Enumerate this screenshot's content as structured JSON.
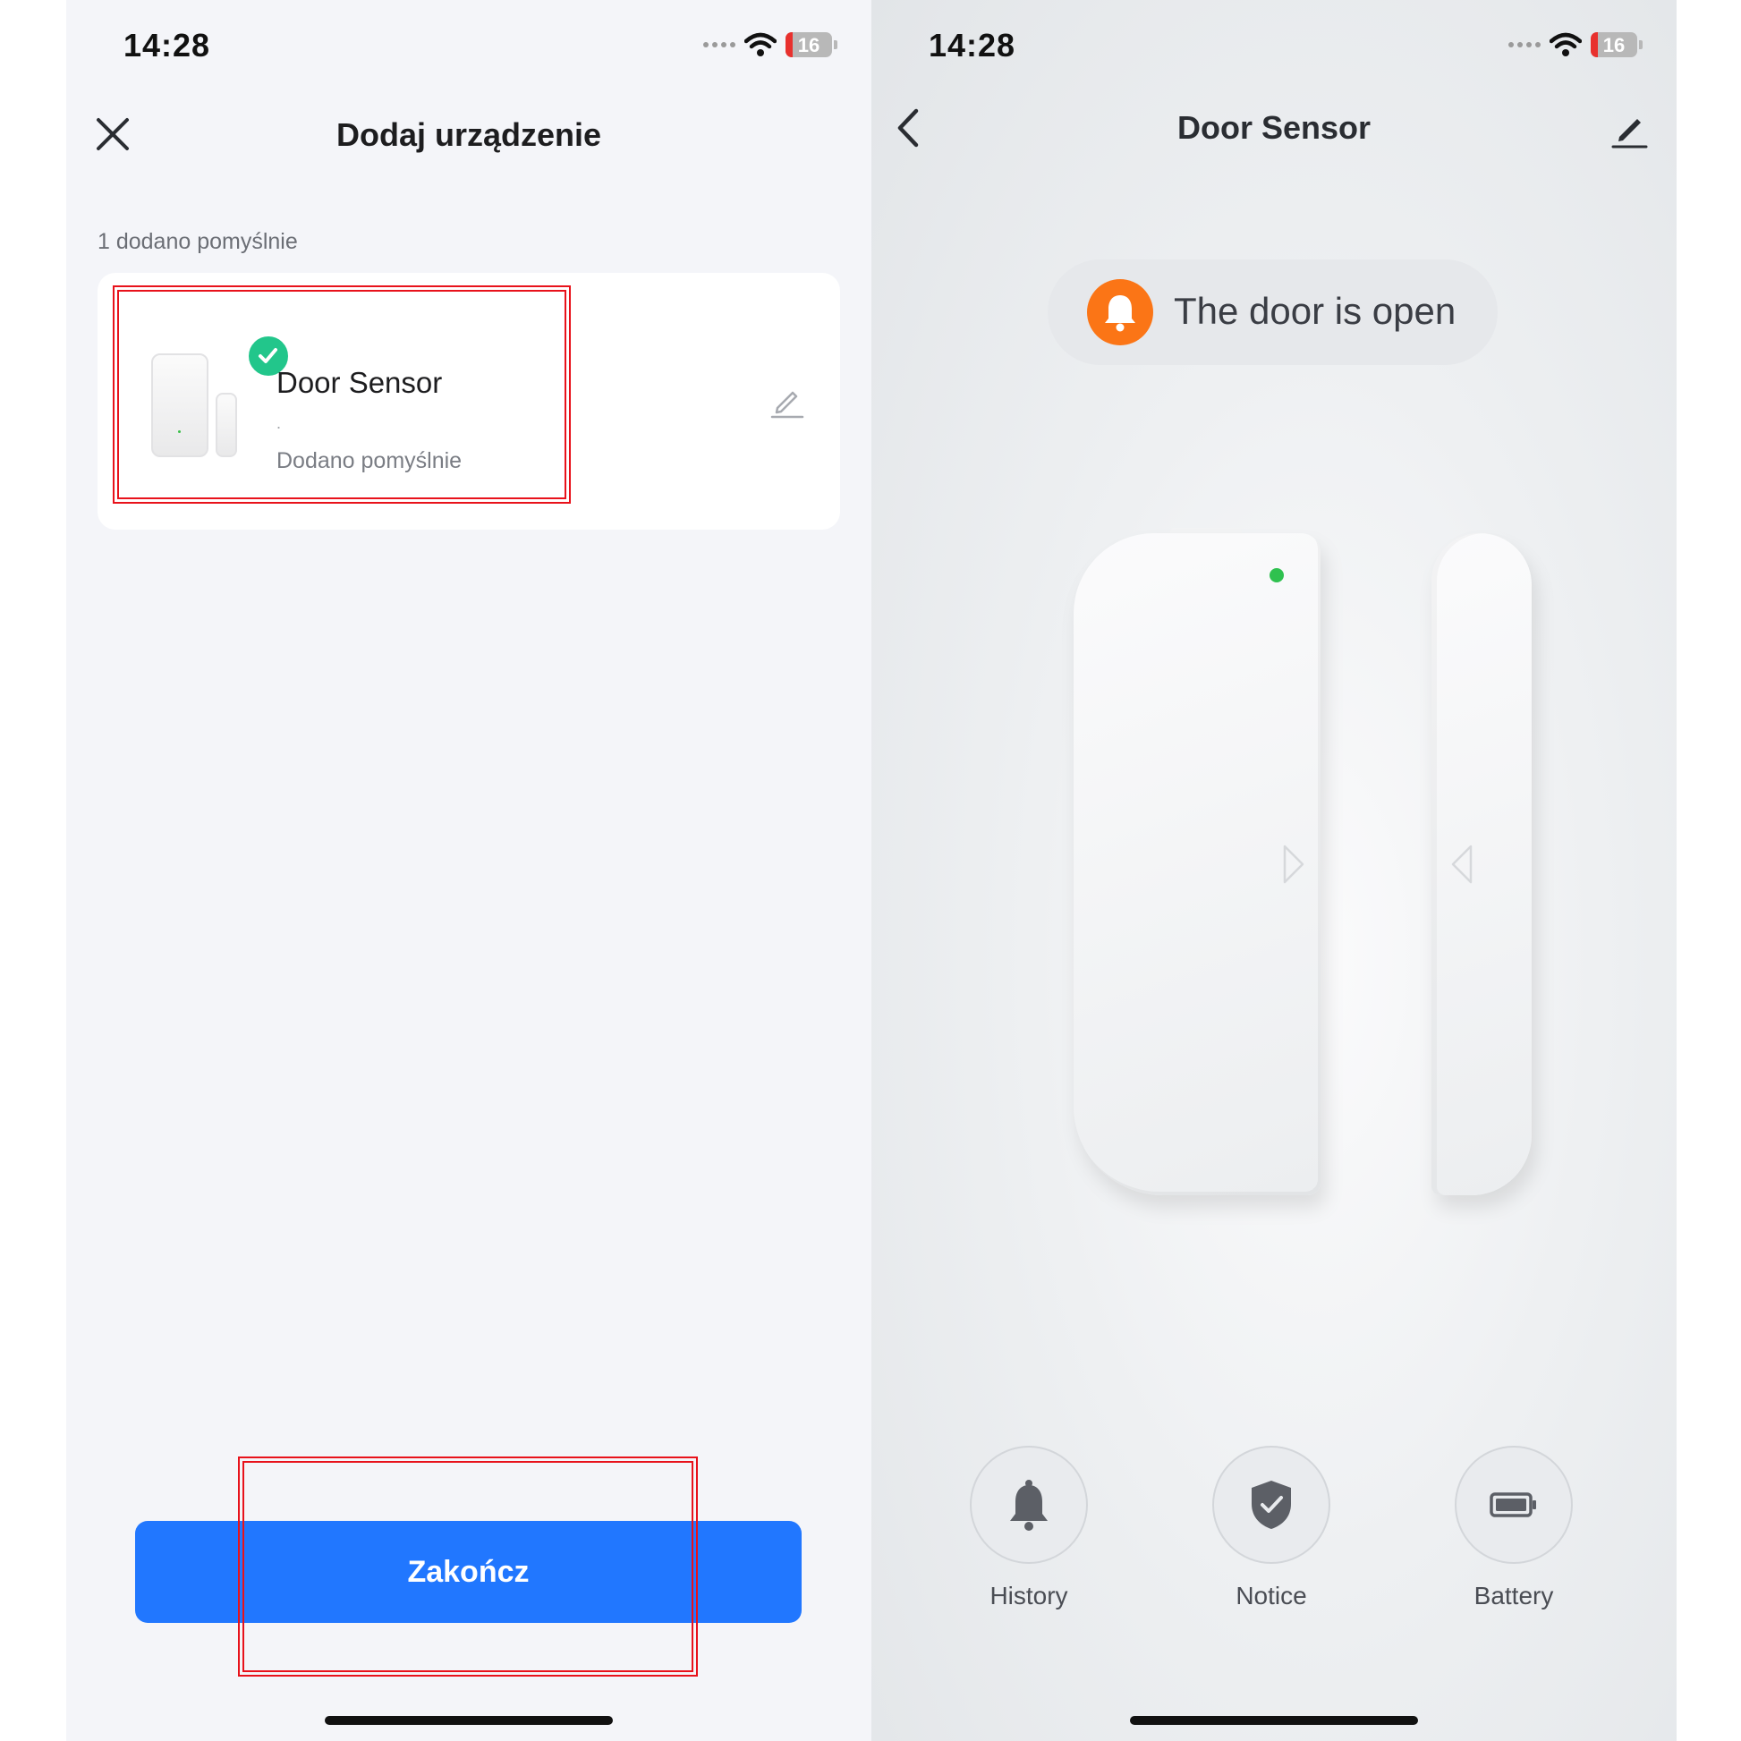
{
  "colors": {
    "primary": "#2177ff",
    "success": "#22c68b",
    "alert": "#fb7516",
    "highlight": "#e8121b",
    "led": "#2fc14f"
  },
  "left": {
    "status": {
      "time": "14:28",
      "battery": "16"
    },
    "header": {
      "title": "Dodaj urządzenie",
      "close_icon": "close-icon"
    },
    "section_label": "1 dodano pomyślnie",
    "device": {
      "name": "Door Sensor",
      "subtitle": ".",
      "status": "Dodano pomyślnie",
      "badge_icon": "check-icon",
      "edit_icon": "pencil-icon"
    },
    "finish_button": "Zakończ"
  },
  "right": {
    "status": {
      "time": "14:28",
      "battery": "16"
    },
    "header": {
      "title": "Door Sensor",
      "back_icon": "back-chevron-icon",
      "edit_icon": "pencil-icon"
    },
    "alert": {
      "text": "The door is open",
      "icon": "bell-icon"
    },
    "actions": [
      {
        "label": "History",
        "icon": "bell-icon"
      },
      {
        "label": "Notice",
        "icon": "shield-check-icon"
      },
      {
        "label": "Battery",
        "icon": "battery-icon"
      }
    ]
  }
}
